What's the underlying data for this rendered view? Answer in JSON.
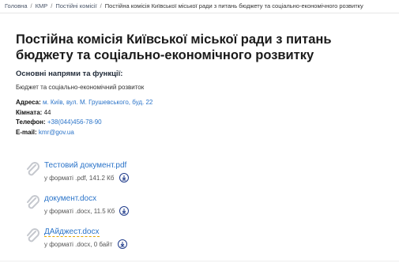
{
  "breadcrumb": {
    "items": [
      "Головна",
      "КМР",
      "Постійні комісії"
    ],
    "current": "Постійна комісія Київської міської ради з питань бюджету та соціально-економічного розвитку"
  },
  "title": "Постійна комісія Київської міської ради з питань бюджету та соціально-економічного розвитку",
  "functions": {
    "heading": "Основні напрями та функції:",
    "text": "Бюджет та соціально-економічний розвиток"
  },
  "contacts": {
    "address_label": "Адреса:",
    "address_value": "м. Київ, вул. М. Грушевського, буд. 22",
    "room_label": "Кімната:",
    "room_value": "44",
    "phone_label": "Телефон:",
    "phone_value": "+38(044)456-78-90",
    "email_label": "E-mail:",
    "email_value": "kmr@gov.ua"
  },
  "files": [
    {
      "name": "Тестовий документ.pdf",
      "meta": "у форматі .pdf, 141.2 Кб",
      "icon": "paperclip-icon"
    },
    {
      "name": "документ.docx",
      "meta": "у форматі .docx, 11.5 Кб",
      "icon": "paperclip-icon"
    },
    {
      "name": "ДАйджест.docx",
      "meta": "у форматі .docx, 0 байт",
      "icon": "paperclip-icon"
    }
  ],
  "colors": {
    "link": "#2b74c9",
    "download_ring": "#1e3a8a"
  }
}
